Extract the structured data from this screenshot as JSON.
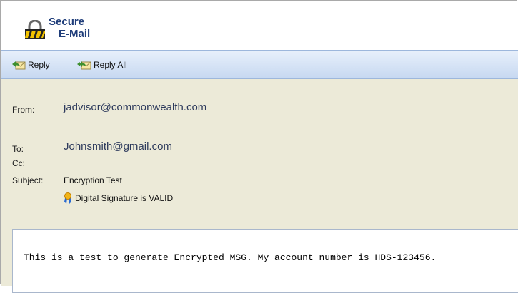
{
  "logo": {
    "line1": "Secure",
    "line2": "E-Mail",
    "icon": "padlock-icon"
  },
  "toolbar": {
    "reply_label": "Reply",
    "reply_all_label": "Reply All"
  },
  "header": {
    "from_label": "From:",
    "from_value": "jadvisor@commonwealth.com",
    "to_label": "To:",
    "to_value": "Johnsmith@gmail.com",
    "cc_label": "Cc:",
    "cc_value": "",
    "subject_label": "Subject:",
    "subject_value": "Encryption Test",
    "signature_status": "Digital Signature is VALID"
  },
  "body": {
    "text": "This is a test to generate Encrypted MSG. My account number is HDS-123456."
  },
  "colors": {
    "header_bg": "#ecead8",
    "toolbar_bg": "#c6d8f1",
    "logo_text": "#1f3d7a"
  }
}
